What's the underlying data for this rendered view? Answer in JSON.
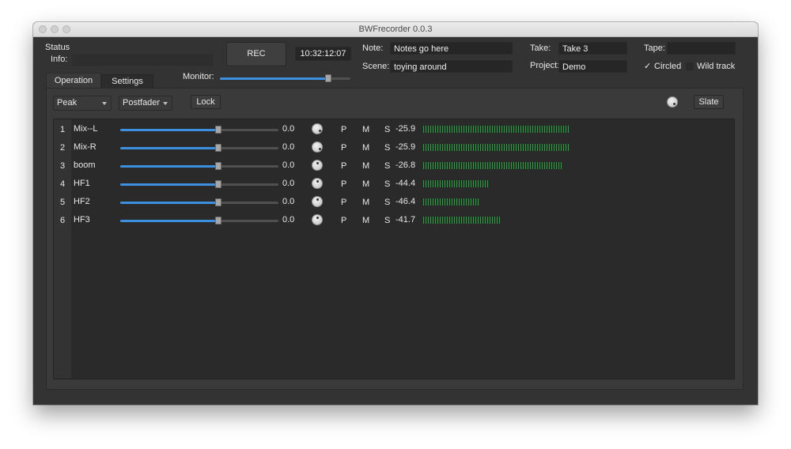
{
  "window": {
    "title": "BWFrecorder 0.0.3"
  },
  "status": {
    "label": "Status",
    "info_label": "Info:",
    "info_value": ""
  },
  "transport": {
    "rec_label": "REC",
    "timecode": "10:32:12:07"
  },
  "meta": {
    "note_label": "Note:",
    "note_value": "Notes go here",
    "scene_label": "Scene:",
    "scene_value": "toying around",
    "take_label": "Take:",
    "take_value": "Take 3",
    "project_label": "Project:",
    "project_value": "Demo",
    "tape_label": "Tape:",
    "tape_value": "",
    "circled_label": "Circled",
    "circled_checked": true,
    "wild_label": "Wild track",
    "wild_checked": false
  },
  "tabs": [
    {
      "label": "Operation",
      "active": true
    },
    {
      "label": "Settings",
      "active": false
    }
  ],
  "monitor": {
    "label": "Monitor:",
    "level": 0.83
  },
  "toolbar": {
    "meter_mode": "Peak",
    "fader_mode": "Postfader",
    "lock_label": "Lock",
    "slate_label": "Slate"
  },
  "colors": {
    "accent": "#3d8fe0",
    "meter": "#1fa83a",
    "panel": "#333333",
    "track_bg": "#262626"
  },
  "channels": [
    {
      "index": "1",
      "name": "Mix--L",
      "fader": 0.62,
      "gain": "0.0",
      "pan": "right",
      "p": "P",
      "m": "M",
      "s": "S",
      "level": "-25.9",
      "meter": 0.62
    },
    {
      "index": "2",
      "name": "Mix-R",
      "fader": 0.62,
      "gain": "0.0",
      "pan": "right",
      "p": "P",
      "m": "M",
      "s": "S",
      "level": "-25.9",
      "meter": 0.62
    },
    {
      "index": "3",
      "name": "boom",
      "fader": 0.62,
      "gain": "0.0",
      "pan": "center",
      "p": "P",
      "m": "M",
      "s": "S",
      "level": "-26.8",
      "meter": 0.59
    },
    {
      "index": "4",
      "name": "HF1",
      "fader": 0.62,
      "gain": "0.0",
      "pan": "center",
      "p": "P",
      "m": "M",
      "s": "S",
      "level": "-44.4",
      "meter": 0.28
    },
    {
      "index": "5",
      "name": "HF2",
      "fader": 0.62,
      "gain": "0.0",
      "pan": "center",
      "p": "P",
      "m": "M",
      "s": "S",
      "level": "-46.4",
      "meter": 0.24
    },
    {
      "index": "6",
      "name": "HF3",
      "fader": 0.62,
      "gain": "0.0",
      "pan": "center",
      "p": "P",
      "m": "M",
      "s": "S",
      "level": "-41.7",
      "meter": 0.33
    }
  ]
}
